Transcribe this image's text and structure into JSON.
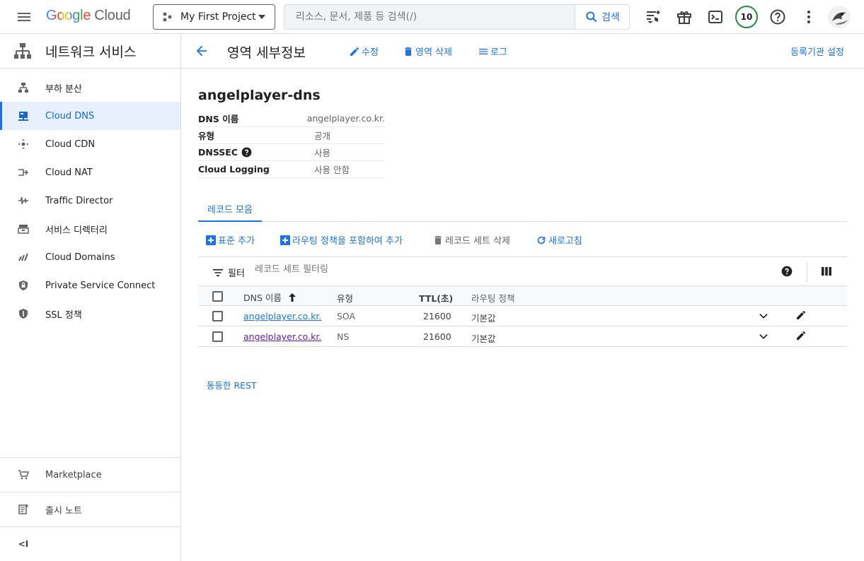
{
  "header": {
    "logo_google": "Google",
    "logo_cloud": "Cloud",
    "project": "My First Project",
    "search_placeholder": "리소스, 문서, 제품 등 검색(/)",
    "search_button": "검색",
    "trial_count": "10",
    "icons": [
      "menu-icon",
      "project-icon",
      "search-icon",
      "announcement-icon",
      "gift-icon",
      "terminal-icon",
      "help-icon",
      "more-vert-icon"
    ]
  },
  "sidebar": {
    "title": "네트워크 서비스",
    "items": [
      {
        "label": "부하 분산",
        "icon": "load-balancing-icon"
      },
      {
        "label": "Cloud DNS",
        "icon": "dns-icon",
        "active": true
      },
      {
        "label": "Cloud CDN",
        "icon": "cdn-icon"
      },
      {
        "label": "Cloud NAT",
        "icon": "nat-icon"
      },
      {
        "label": "Traffic Director",
        "icon": "traffic-director-icon"
      },
      {
        "label": "서비스 디렉터리",
        "icon": "service-directory-icon"
      },
      {
        "label": "Cloud Domains",
        "icon": "domains-icon"
      },
      {
        "label": "Private Service Connect",
        "icon": "private-connect-icon"
      },
      {
        "label": "SSL 정책",
        "icon": "shield-icon"
      }
    ],
    "marketplace": "Marketplace",
    "release_notes": "출시 노트",
    "collapse": "<I"
  },
  "page": {
    "title": "영역 세부정보",
    "edit": "수정",
    "delete_zone": "영역 삭제",
    "logs": "로그",
    "registrar": "등록기관 설정",
    "zone_name": "angelplayer-dns",
    "details": [
      {
        "key": "DNS 이름",
        "value": "angelplayer.co.kr."
      },
      {
        "key": "유형",
        "value": "공개"
      },
      {
        "key": "DNSSEC",
        "value": "사용",
        "help": true
      },
      {
        "key": "Cloud Logging",
        "value": "사용 안함"
      }
    ],
    "tab": "레코드 모음",
    "toolbar": {
      "add_standard": "표준 추가",
      "add_routing": "라우팅 정책을 포함하여 추가",
      "delete_records": "레코드 세트 삭제",
      "refresh": "새로고침"
    },
    "filter_label": "필터",
    "filter_placeholder": "레코드 세트 필터링",
    "table": {
      "columns": [
        "DNS 이름",
        "유형",
        "TTL(초)",
        "라우팅 정책"
      ],
      "rows": [
        {
          "name": "angelplayer.co.kr.",
          "type": "SOA",
          "ttl": "21600",
          "policy": "기본값"
        },
        {
          "name": "angelplayer.co.kr.",
          "type": "NS",
          "ttl": "21600",
          "policy": "기본값"
        }
      ]
    },
    "equivalent_rest": "동등한 REST"
  }
}
